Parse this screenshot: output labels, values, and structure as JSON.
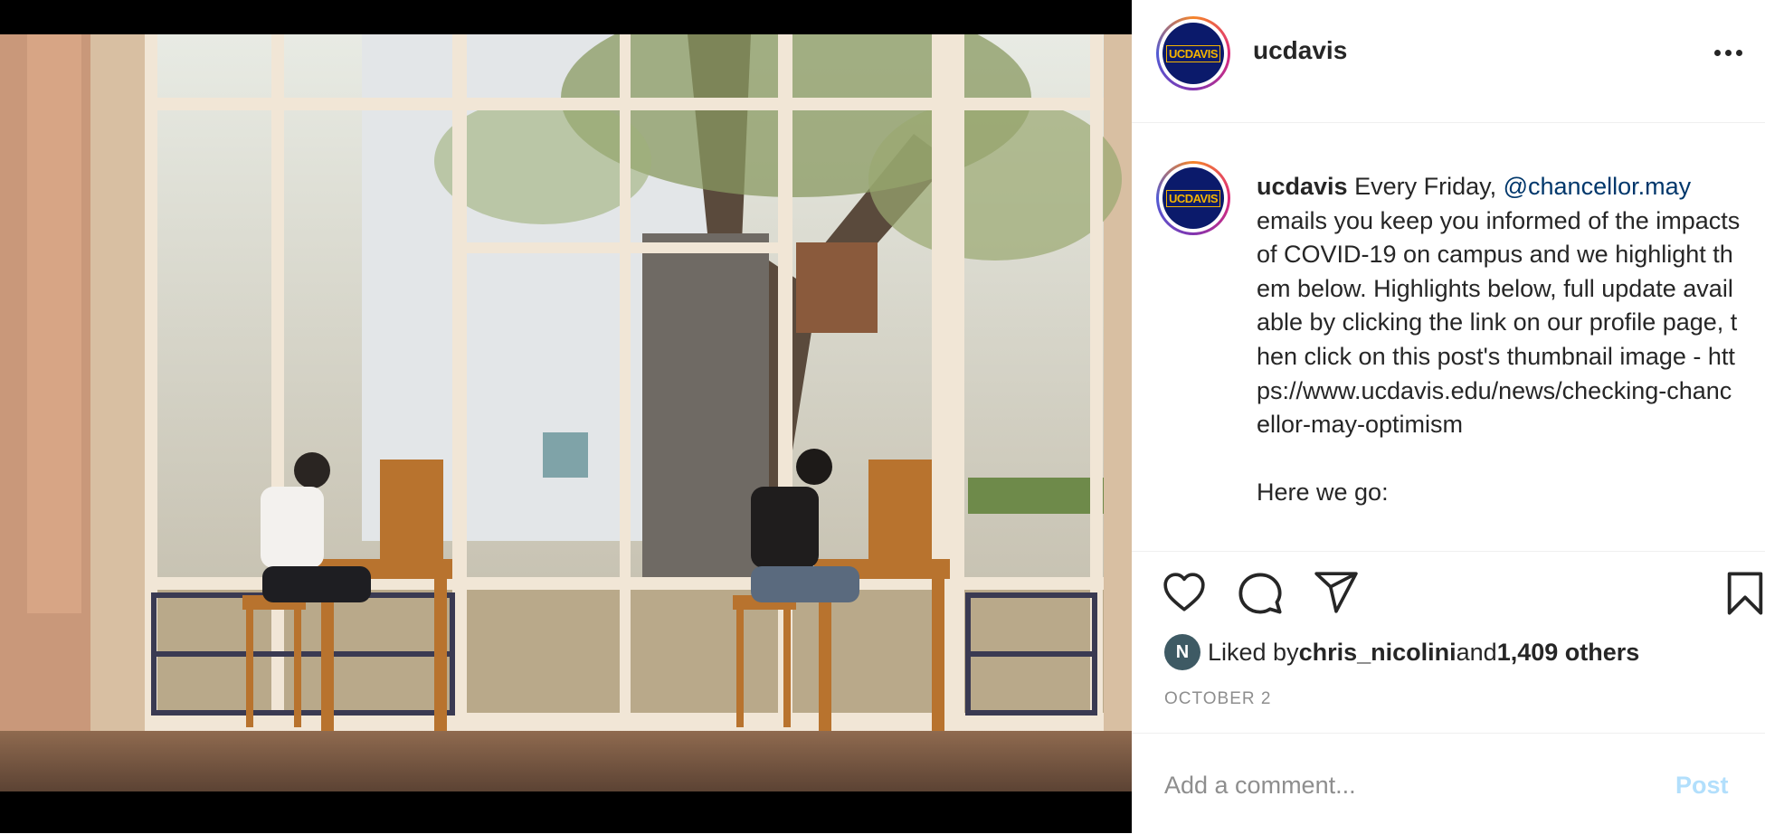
{
  "post": {
    "username": "ucdavis",
    "avatar_text": "UCDAVIS",
    "caption": {
      "username": "ucdavis",
      "lead": " Every Friday, ",
      "mention": "@chancellor.may",
      "body": "\nemails you keep you informed of the impacts of COVID-19 on campus and we highlight them below. Highlights below, full update available by clicking the link on our profile page, then click on this post's thumbnail image - https://www.ucdavis.edu/news/checking-chancellor-may-optimism\n\nHere we go:"
    },
    "likes": {
      "prefix": "Liked by ",
      "user": "chris_nicolini",
      "middle": " and ",
      "others": "1,409 others",
      "avatar_letter": "N"
    },
    "date": "OCTOBER 2"
  },
  "comment": {
    "placeholder": "Add a comment...",
    "post_label": "Post"
  },
  "icons": {
    "more": "more-options-icon",
    "like": "heart-icon",
    "comment": "comment-bubble-icon",
    "share": "paper-plane-icon",
    "save": "bookmark-icon"
  },
  "colors": {
    "mention": "#00376b",
    "post_button_disabled": "#b2dffc",
    "avatar_bg": "#0b1a6b",
    "avatar_text": "#f4b400"
  }
}
